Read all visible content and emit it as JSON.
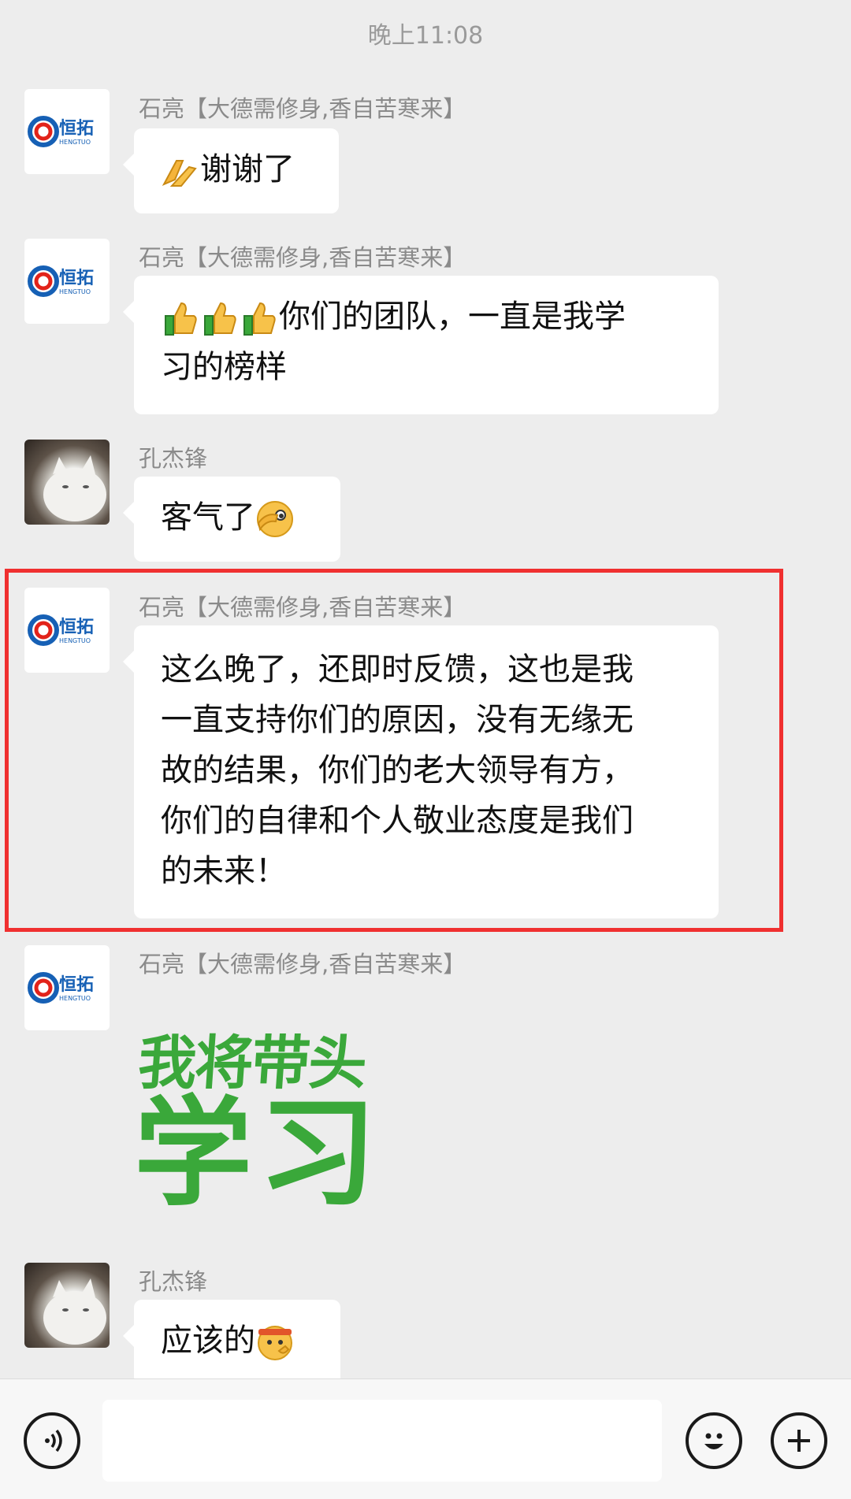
{
  "header": {
    "time": "晚上11:08"
  },
  "messages": [
    {
      "sender": "石亮【大德需修身,香自苦寒来】",
      "avatar": "logo",
      "lines": [
        "谢谢了"
      ],
      "emoji": "folded-hands"
    },
    {
      "sender": "石亮【大德需修身,香自苦寒来】",
      "avatar": "logo",
      "lines": [
        "你们的团队，一直是我学",
        "习的榜样"
      ],
      "emoji": "thumbs-up x3"
    },
    {
      "sender": "孔杰锋",
      "avatar": "cat",
      "lines": [
        "客气了"
      ],
      "emoji": "face-peeking"
    },
    {
      "sender": "石亮【大德需修身,香自苦寒来】",
      "avatar": "logo",
      "lines": [
        "这么晚了，还即时反馈，这也是我",
        "一直支持你们的原因，没有无缘无",
        "故的结果，你们的老大领导有方，",
        "你们的自律和个人敬业态度是我们",
        "的未来！"
      ],
      "highlighted": true
    },
    {
      "sender": "石亮【大德需修身,香自苦寒来】",
      "avatar": "logo",
      "sticker": {
        "line1": "我将带头",
        "line2": "学习"
      }
    },
    {
      "sender": "孔杰锋",
      "avatar": "cat",
      "lines": [
        "应该的"
      ],
      "emoji": "saluting-face"
    }
  ],
  "logo": {
    "cn": "恒拓",
    "en": "HENGTUO"
  },
  "input_bar": {
    "voice_icon": "voice-icon",
    "emoji_icon": "emoji-icon",
    "plus_icon": "plus-icon"
  }
}
